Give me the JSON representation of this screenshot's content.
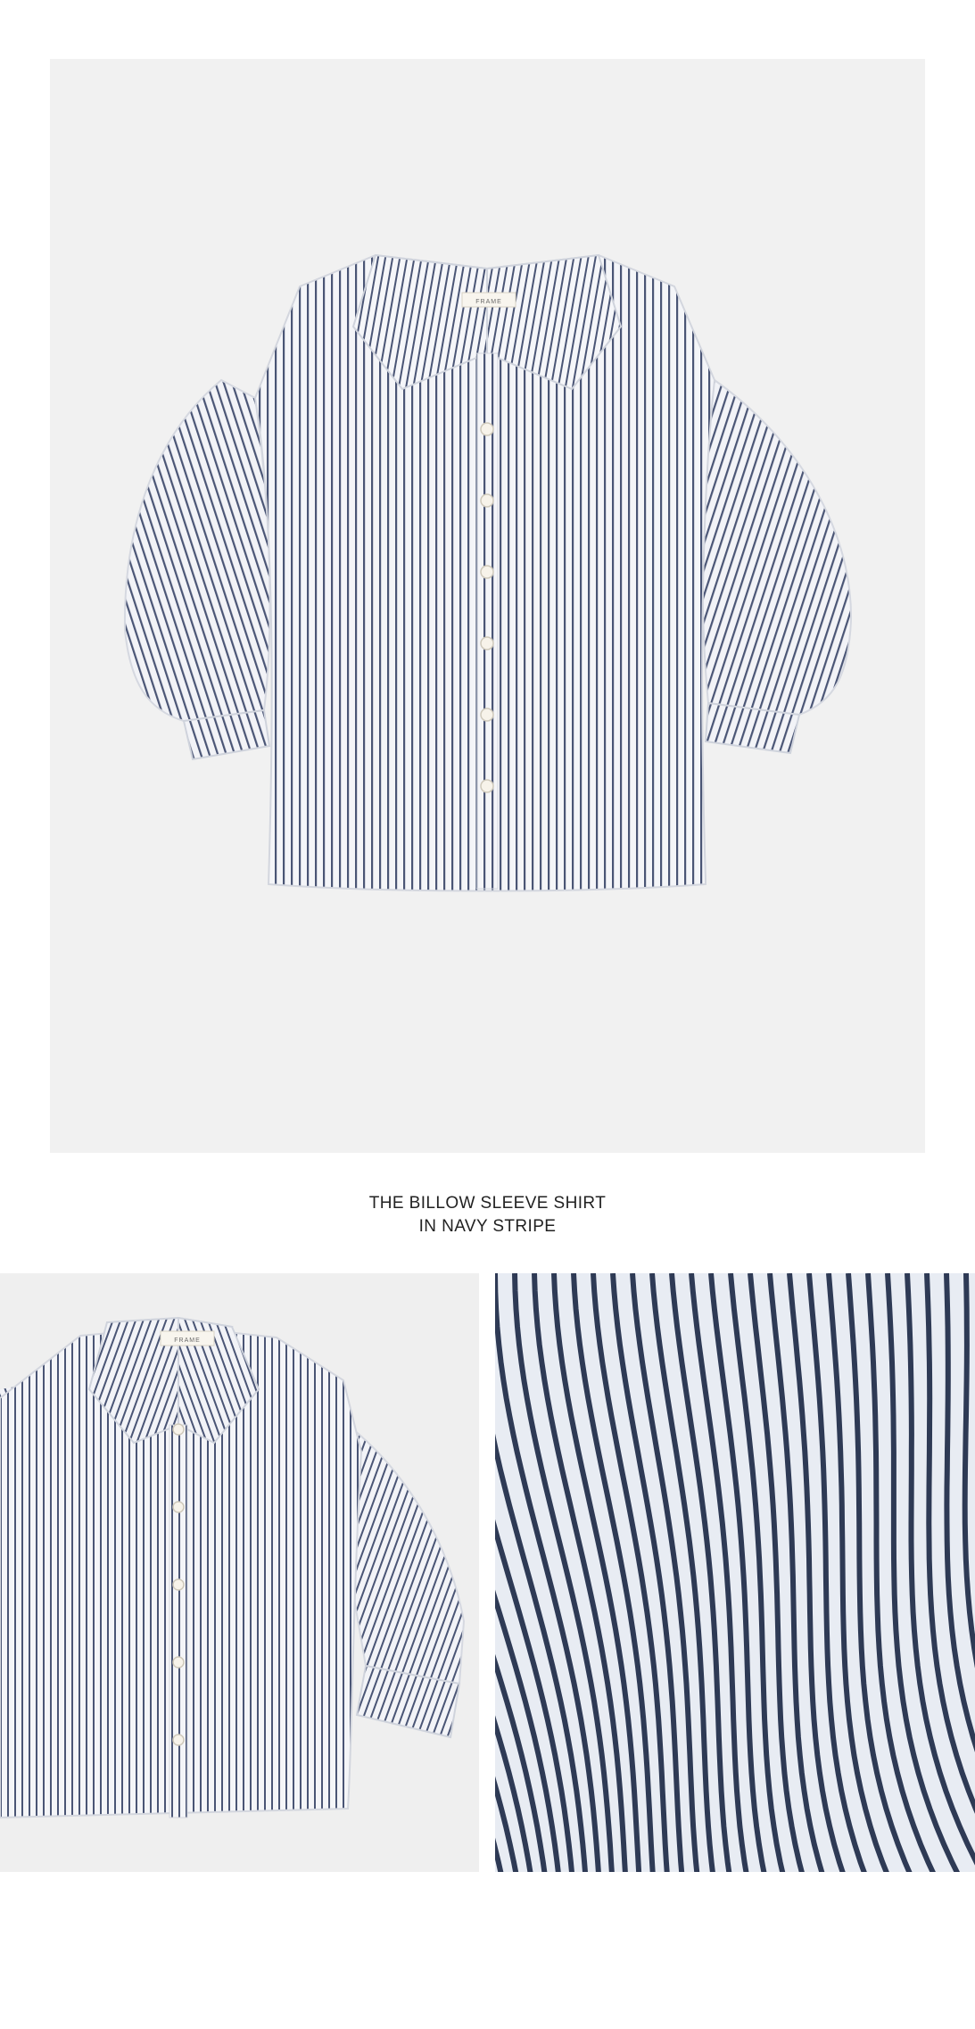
{
  "product": {
    "title_line1": "THE BILLOW SLEEVE SHIRT",
    "title_line2": "IN NAVY STRIPE"
  },
  "label_text": "FRAME",
  "colors": {
    "background": "#f1f1f1",
    "stripe_navy": "#3f4a6b",
    "fabric_white": "#f4f5f8",
    "button_ivory": "#f7f3ea"
  },
  "images": [
    {
      "name": "hero-product-image"
    },
    {
      "name": "front-detail-image"
    },
    {
      "name": "fabric-closeup-image"
    }
  ]
}
